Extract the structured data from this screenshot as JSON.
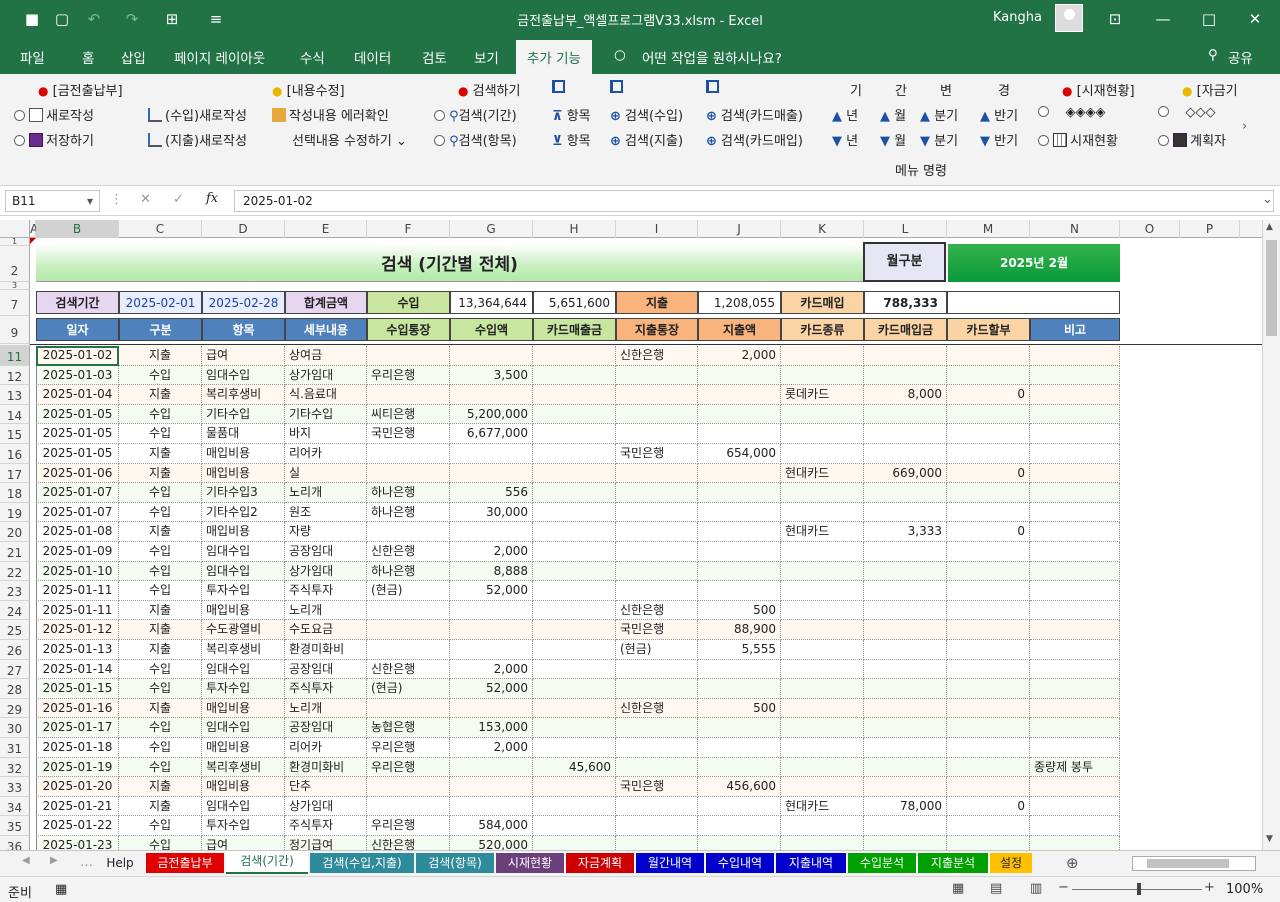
{
  "window": {
    "title": "금전출납부_액셀프로그램V33.xlsm  -  Excel",
    "user": "Kangha"
  },
  "menu": {
    "tabs": [
      "파일",
      "홈",
      "삽입",
      "페이지 레이아웃",
      "수식",
      "데이터",
      "검토",
      "보기",
      "추가 기능"
    ],
    "tell_me": "어떤 작업을 원하시나요?",
    "share": "공유"
  },
  "ribbon": {
    "grp1": "[금전출납부]",
    "new": "새로작성",
    "save": "저장하기",
    "income_new": "(수입)새로작성",
    "expense_new": "(지출)새로작성",
    "grp2": "[내용수정]",
    "check": "작성내용 에러확인",
    "modify": "선택내용 수정하기",
    "grp3": "검색하기",
    "s_period": "검색(기간)",
    "s_item": "검색(항목)",
    "item1": "항목",
    "item2": "항목",
    "s_income": "검색(수입)",
    "s_expense": "검색(지출)",
    "s_card_sale": "검색(카드매출)",
    "s_card_buy": "검색(카드매입)",
    "period_chars": [
      "기",
      "간",
      "변",
      "경"
    ],
    "year1": "년",
    "month1": "월",
    "qtr1": "분기",
    "half1": "반기",
    "year2": "년",
    "month2": "월",
    "qtr2": "분기",
    "half2": "반기",
    "grp4": "[시재현황]",
    "diamonds1": "◈◈◈◈",
    "cash_status": "시재현황",
    "grp5": "[자금기",
    "diamonds2": "◇◇◇",
    "plan": "계획자",
    "group_label": "메뉴 명령"
  },
  "formula": {
    "cell_ref": "B11",
    "value": "2025-01-02"
  },
  "columns": [
    "A",
    "B",
    "C",
    "D",
    "E",
    "F",
    "G",
    "H",
    "I",
    "J",
    "K",
    "L",
    "M",
    "N",
    "O",
    "P"
  ],
  "sheet": {
    "title": "검색 (기간별 전체)",
    "month_label": "월구분",
    "month_value": "2025년 2월",
    "summary": {
      "period_label": "검색기간",
      "start": "2025-02-01",
      "end": "2025-02-28",
      "total_label": "합계금액",
      "income_label": "수입",
      "income_value": "13,364,644",
      "card_sale_value": "5,651,600",
      "expense_label": "지출",
      "expense_value": "1,208,055",
      "card_buy_label": "카드매입",
      "card_buy_value": "788,333"
    },
    "headers": [
      "일자",
      "구분",
      "항목",
      "세부내용",
      "수입통장",
      "수입액",
      "카드매출금",
      "지출통장",
      "지출액",
      "카드종류",
      "카드매입금",
      "카드할부",
      "비고"
    ],
    "row_numbers": [
      "11",
      "12",
      "13",
      "14",
      "15",
      "16",
      "17",
      "18",
      "19",
      "20",
      "21",
      "22",
      "23",
      "24",
      "25",
      "26",
      "27",
      "28",
      "29",
      "30",
      "31",
      "32",
      "33",
      "34",
      "35",
      "36"
    ],
    "rows": [
      [
        "2025-01-02",
        "지출",
        "급여",
        "상여금",
        "",
        "",
        "",
        "신한은행",
        "2,000",
        "",
        "",
        "",
        ""
      ],
      [
        "2025-01-03",
        "수입",
        "임대수입",
        "상가임대",
        "우리은행",
        "3,500",
        "",
        "",
        "",
        "",
        "",
        "",
        ""
      ],
      [
        "2025-01-04",
        "지출",
        "복리후생비",
        "식.음료대",
        "",
        "",
        "",
        "",
        "",
        "롯데카드",
        "8,000",
        "0",
        ""
      ],
      [
        "2025-01-05",
        "수입",
        "기타수입",
        "기타수입",
        "씨티은행",
        "5,200,000",
        "",
        "",
        "",
        "",
        "",
        "",
        ""
      ],
      [
        "2025-01-05",
        "수입",
        "물품대",
        "바지",
        "국민은행",
        "6,677,000",
        "",
        "",
        "",
        "",
        "",
        "",
        ""
      ],
      [
        "2025-01-05",
        "지출",
        "매입비용",
        "리어카",
        "",
        "",
        "",
        "국민은행",
        "654,000",
        "",
        "",
        "",
        ""
      ],
      [
        "2025-01-06",
        "지출",
        "매입비용",
        "실",
        "",
        "",
        "",
        "",
        "",
        "현대카드",
        "669,000",
        "0",
        ""
      ],
      [
        "2025-01-07",
        "수입",
        "기타수입3",
        "노리개",
        "하나은행",
        "556",
        "",
        "",
        "",
        "",
        "",
        "",
        ""
      ],
      [
        "2025-01-07",
        "수입",
        "기타수입2",
        "원조",
        "하나은행",
        "30,000",
        "",
        "",
        "",
        "",
        "",
        "",
        ""
      ],
      [
        "2025-01-08",
        "지출",
        "매입비용",
        "자량",
        "",
        "",
        "",
        "",
        "",
        "현대카드",
        "3,333",
        "0",
        ""
      ],
      [
        "2025-01-09",
        "수입",
        "임대수입",
        "공장임대",
        "신한은행",
        "2,000",
        "",
        "",
        "",
        "",
        "",
        "",
        ""
      ],
      [
        "2025-01-10",
        "수입",
        "임대수입",
        "상가임대",
        "하나은행",
        "8,888",
        "",
        "",
        "",
        "",
        "",
        "",
        ""
      ],
      [
        "2025-01-11",
        "수입",
        "투자수입",
        "주식투자",
        "(현금)",
        "52,000",
        "",
        "",
        "",
        "",
        "",
        "",
        ""
      ],
      [
        "2025-01-11",
        "지출",
        "매입비용",
        "노리개",
        "",
        "",
        "",
        "신한은행",
        "500",
        "",
        "",
        "",
        ""
      ],
      [
        "2025-01-12",
        "지출",
        "수도광열비",
        "수도요금",
        "",
        "",
        "",
        "국민은행",
        "88,900",
        "",
        "",
        "",
        ""
      ],
      [
        "2025-01-13",
        "지출",
        "복리후생비",
        "환경미화비",
        "",
        "",
        "",
        "(현금)",
        "5,555",
        "",
        "",
        "",
        ""
      ],
      [
        "2025-01-14",
        "수입",
        "임대수입",
        "공장임대",
        "신한은행",
        "2,000",
        "",
        "",
        "",
        "",
        "",
        "",
        ""
      ],
      [
        "2025-01-15",
        "수입",
        "투자수입",
        "주식투자",
        "(현금)",
        "52,000",
        "",
        "",
        "",
        "",
        "",
        "",
        ""
      ],
      [
        "2025-01-16",
        "지출",
        "매입비용",
        "노리개",
        "",
        "",
        "",
        "신한은행",
        "500",
        "",
        "",
        "",
        ""
      ],
      [
        "2025-01-17",
        "수입",
        "임대수입",
        "공장임대",
        "농협은행",
        "153,000",
        "",
        "",
        "",
        "",
        "",
        "",
        ""
      ],
      [
        "2025-01-18",
        "수입",
        "매입비용",
        "리어카",
        "우리은행",
        "2,000",
        "",
        "",
        "",
        "",
        "",
        "",
        ""
      ],
      [
        "2025-01-19",
        "수입",
        "복리후생비",
        "환경미화비",
        "우리은행",
        "",
        "45,600",
        "",
        "",
        "",
        "",
        "",
        "종량제 봉투"
      ],
      [
        "2025-01-20",
        "지출",
        "매입비용",
        "단추",
        "",
        "",
        "",
        "국민은행",
        "456,600",
        "",
        "",
        "",
        ""
      ],
      [
        "2025-01-21",
        "지출",
        "임대수입",
        "상가임대",
        "",
        "",
        "",
        "",
        "",
        "현대카드",
        "78,000",
        "0",
        ""
      ],
      [
        "2025-01-22",
        "수입",
        "투자수입",
        "주식투자",
        "우리은행",
        "584,000",
        "",
        "",
        "",
        "",
        "",
        "",
        ""
      ],
      [
        "2025-01-23",
        "수입",
        "급여",
        "정기급여",
        "신한은행",
        "520,000",
        "",
        "",
        "",
        "",
        "",
        "",
        ""
      ]
    ]
  },
  "sheet_tabs": [
    {
      "label": "Help",
      "bg": "#f3f3f3",
      "fg": "#222"
    },
    {
      "label": "금전출납부",
      "bg": "#e00000",
      "fg": "#fff"
    },
    {
      "label": "검색(기간)",
      "bg": "#ffffff",
      "fg": "#217346"
    },
    {
      "label": "검색(수입,지출)",
      "bg": "#2e8b9c",
      "fg": "#fff"
    },
    {
      "label": "검색(항목)",
      "bg": "#2e8b9c",
      "fg": "#fff"
    },
    {
      "label": "시재현황",
      "bg": "#6b3f7a",
      "fg": "#fff"
    },
    {
      "label": "자금계획",
      "bg": "#cc0000",
      "fg": "#fff"
    },
    {
      "label": "월간내역",
      "bg": "#0000cc",
      "fg": "#fff"
    },
    {
      "label": "수입내역",
      "bg": "#0000cc",
      "fg": "#fff"
    },
    {
      "label": "지출내역",
      "bg": "#0000cc",
      "fg": "#fff"
    },
    {
      "label": "수입분석",
      "bg": "#00a000",
      "fg": "#fff"
    },
    {
      "label": "지출분석",
      "bg": "#00a000",
      "fg": "#fff"
    },
    {
      "label": "설정",
      "bg": "#ffc000",
      "fg": "#222"
    }
  ],
  "status": {
    "ready": "준비",
    "zoom": "100%"
  },
  "colors": {
    "excel_green": "#217346",
    "header_blue": "#4f81bd",
    "income_green": "#d6ecb0",
    "expense_orange": "#f8b47c",
    "card_header": "#fbd4a6"
  }
}
